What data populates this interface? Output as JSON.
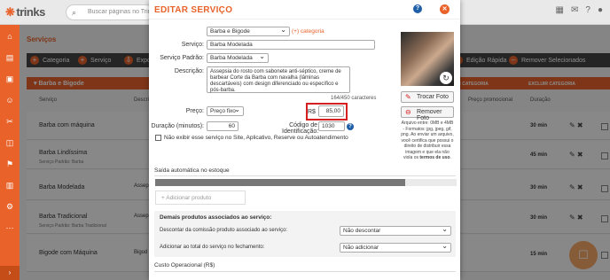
{
  "app": {
    "logo": "trinks",
    "search_placeholder": "Buscar páginas no Trinks"
  },
  "page": {
    "title": "Serviços"
  },
  "toolbar": {
    "categoria": "Categoria",
    "servico": "Serviço",
    "export": "Expo",
    "edicao_rapida": "Edição Rápida",
    "remover": "Remover Selecionados"
  },
  "group": {
    "name": "Barba e Bigode",
    "right_headers": [
      "ATIVAR CATEGORIA",
      "EXCLUIR CATEGORIA"
    ]
  },
  "table": {
    "headers": [
      "Serviço",
      "Descri",
      "Preço promocional",
      "Duração"
    ],
    "rows": [
      {
        "name": "Barba com máquina",
        "sub": "",
        "clip": "",
        "duration": "30 min"
      },
      {
        "name": "Barba Lindíssima",
        "sub": "Serviço Padrão: Barba",
        "clip": "",
        "duration": "45 min"
      },
      {
        "name": "Barba Modelada",
        "sub": "",
        "clip": "Assep",
        "duration": "30 min"
      },
      {
        "name": "Barba Tradicional",
        "sub": "Serviço Padrão: Barba Tradicional",
        "clip": "Assep",
        "duration": "30 min"
      },
      {
        "name": "Bigode com Máquina",
        "sub": "",
        "clip": "Bigod",
        "duration": "15 min"
      }
    ]
  },
  "modal": {
    "title": "EDITAR SERVIÇO",
    "labels": {
      "categoria": "Categoria:",
      "servico": "Serviço:",
      "padrao": "Serviço Padrão:",
      "descricao": "Descrição:",
      "preco": "Preço:",
      "duracao": "Duração (minutos):",
      "codigo": "Código de Identificação:"
    },
    "categoria_value": "Barba e Bigode",
    "add_categoria": "(+) categoria",
    "servico_value": "Barba Modelada",
    "padrao_value": "Barba Modelada",
    "descricao_value": "Assepsia do rosto com sabonete anti-séptico, creme de barbear Corte da Barba com navalha (lâminas descartáveis) com design diferenciado ou específico e pós-barba.",
    "char_counter": "164/450 caracteres",
    "preco_tipo": "Preço fixo",
    "currency": "R$",
    "preco_value": "85,00",
    "duracao_value": "60",
    "codigo_value": "1030",
    "nao_exibir": "Não exibir esse serviço no Site, Aplicativo, Reserve ou Autoatendimento",
    "trocar_foto": "Trocar Foto",
    "remover_foto": "Remover Foto",
    "hint_text": "Arquivo entre: 0MB e 4MB - Formatos: jpg, jpeg, gif, png. Ao enviar um arquivo, você certifica que possui o direito de distribuir essa imagem e que ela não viola os",
    "hint_terms": "termos de uso",
    "saida_title": "Saída automática no estoque",
    "stock_fill": 0.83,
    "adicionar_produto": "+ Adicionar produto",
    "demais_title": "Demais produtos associados ao serviço:",
    "desconto_label": "Descontar da comissão produto associado ao serviço:",
    "desconto_value": "Não descontar",
    "adicionar_label": "Adicionar ao total do serviço no fechamento:",
    "adicionar_value": "Não adicionar",
    "custo_title": "Custo Operacional (R$)"
  }
}
